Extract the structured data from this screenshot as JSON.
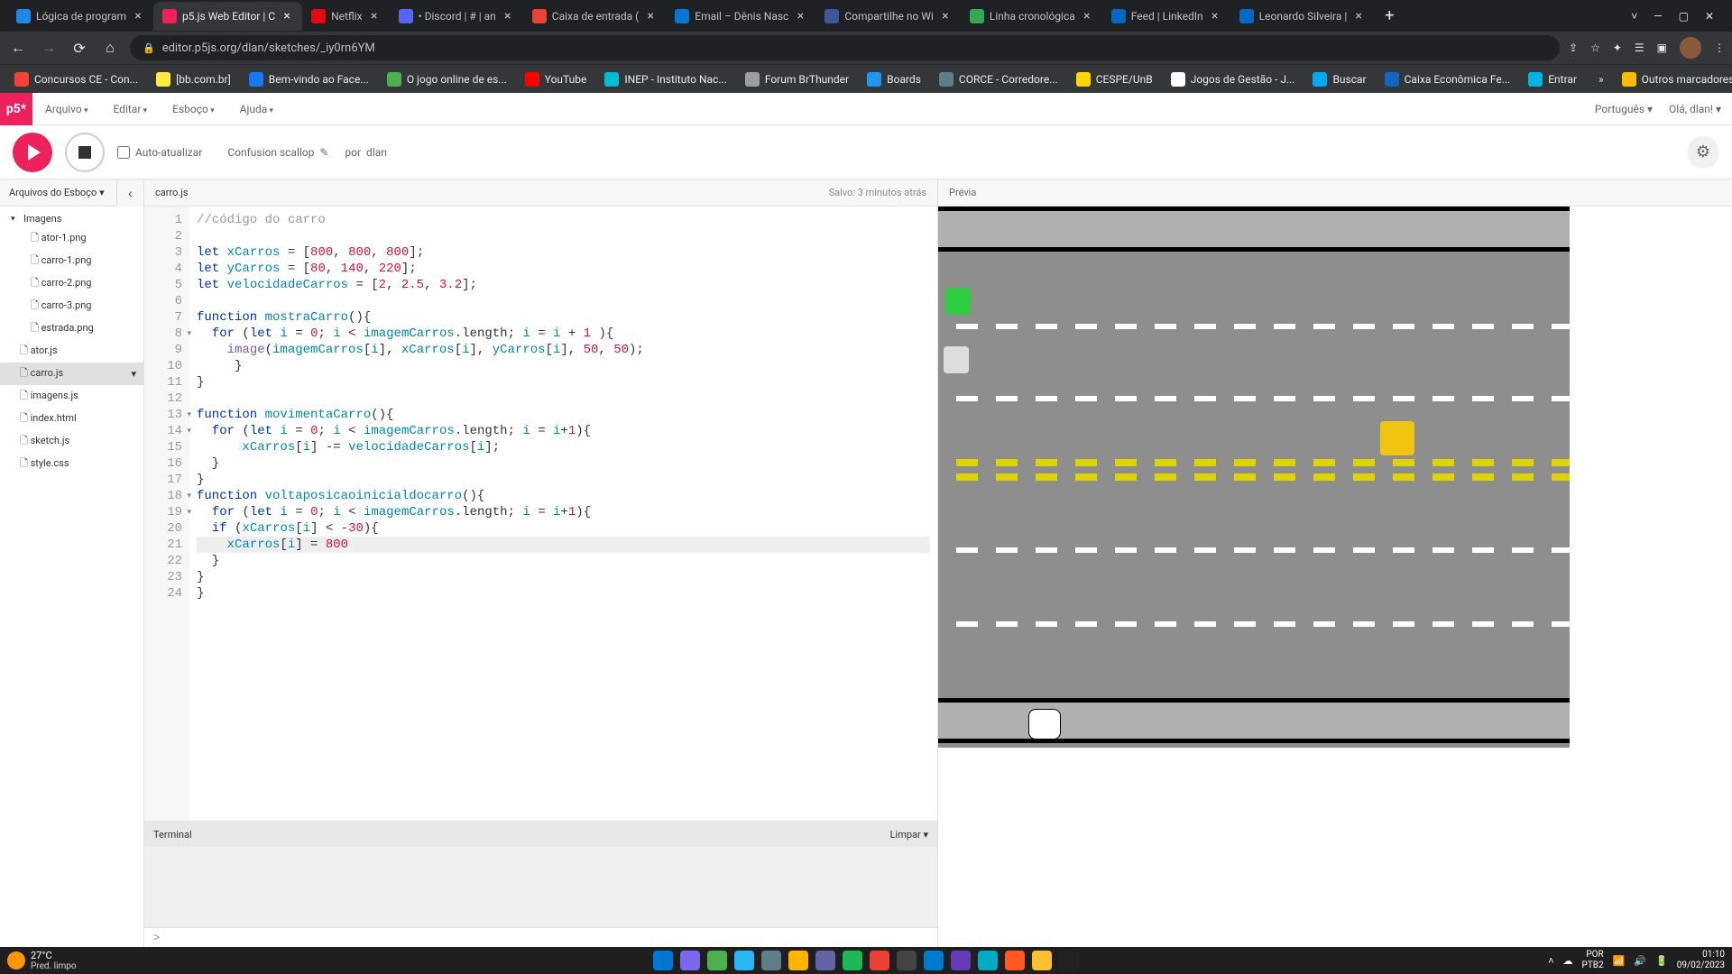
{
  "browser": {
    "tabs": [
      {
        "title": "Lógica de program",
        "fav": "#1e88e5"
      },
      {
        "title": "p5.js Web Editor | C",
        "fav": "#ed225d",
        "active": true
      },
      {
        "title": "Netflix",
        "fav": "#e50914"
      },
      {
        "title": "• Discord | # | an",
        "fav": "#5865f2"
      },
      {
        "title": "Caixa de entrada (",
        "fav": "#ea4335"
      },
      {
        "title": "Email – Dênis Nasc",
        "fav": "#0078d4"
      },
      {
        "title": "Compartilhe no Wi",
        "fav": "#3b5998"
      },
      {
        "title": "Linha cronológica",
        "fav": "#34a853"
      },
      {
        "title": "Feed | LinkedIn",
        "fav": "#0a66c2"
      },
      {
        "title": "Leonardo Silveira |",
        "fav": "#0a66c2"
      }
    ],
    "url": "editor.p5js.org/dlan/sketches/_iy0rn6YM",
    "bookmarks": [
      {
        "label": "Concursos CE - Con...",
        "color": "#f44336"
      },
      {
        "label": "[bb.com.br]",
        "color": "#ffeb3b"
      },
      {
        "label": "Bem-vindo ao Face...",
        "color": "#1877f2"
      },
      {
        "label": "O jogo online de es...",
        "color": "#4caf50"
      },
      {
        "label": "YouTube",
        "color": "#ff0000"
      },
      {
        "label": "INEP - Instituto Nac...",
        "color": "#00bcd4"
      },
      {
        "label": "Forum BrThunder",
        "color": "#9e9e9e"
      },
      {
        "label": "Boards",
        "color": "#2196f3"
      },
      {
        "label": "CORCE - Corredore...",
        "color": "#607d8b"
      },
      {
        "label": "CESPE/UnB",
        "color": "#ffd600"
      },
      {
        "label": "Jogos de Gestão - J...",
        "color": "#fff"
      },
      {
        "label": "Buscar",
        "color": "#03a9f4"
      },
      {
        "label": "Caixa Econômica Fe...",
        "color": "#1565c0"
      },
      {
        "label": "Entrar",
        "color": "#00b5e2"
      }
    ],
    "bookmarks_more": "»",
    "bookmarks_other": "Outros marcadores"
  },
  "p5": {
    "logo": "p5*",
    "menu": [
      "Arquivo",
      "Editar",
      "Esboço",
      "Ajuda"
    ],
    "language": "Português ▾",
    "greeting": "Olá, dlan! ▾",
    "auto_update": "Auto-atualizar",
    "sketch_name": "Confusion scallop",
    "author_prefix": "por",
    "author": "dlan",
    "sidebar_title": "Arquivos do Esboço ▾",
    "files": {
      "folder": "Imagens",
      "images": [
        "ator-1.png",
        "carro-1.png",
        "carro-2.png",
        "carro-3.png",
        "estrada.png"
      ],
      "root": [
        "ator.js",
        "carro.js",
        "imagens.js",
        "index.html",
        "sketch.js",
        "style.css"
      ],
      "selected": "carro.js"
    },
    "tab": "carro.js",
    "saved": "Salvo: 3 minutos atrás",
    "preview_label": "Prévia",
    "terminal_label": "Terminal",
    "terminal_clear": "Limpar ▾",
    "terminal_prompt": ">"
  },
  "code": {
    "lines": 24,
    "fold_lines": [
      8,
      13,
      14,
      18,
      19
    ],
    "highlight_line": 21
  },
  "taskbar": {
    "temp": "27°C",
    "cond": "Pred. limpo",
    "icons": [
      "#0078d4",
      "#7b68ee",
      "#4caf50",
      "#29b6f6",
      "#607d8b",
      "#ffb300",
      "#6264a7",
      "#1db954",
      "#ea4335",
      "#444",
      "#007acc",
      "#673ab7",
      "#00acc1",
      "#ff5722",
      "#fbc02d",
      "#222"
    ],
    "lang1": "POR",
    "lang2": "PTB2",
    "time": "01:10",
    "date": "09/02/2023"
  }
}
